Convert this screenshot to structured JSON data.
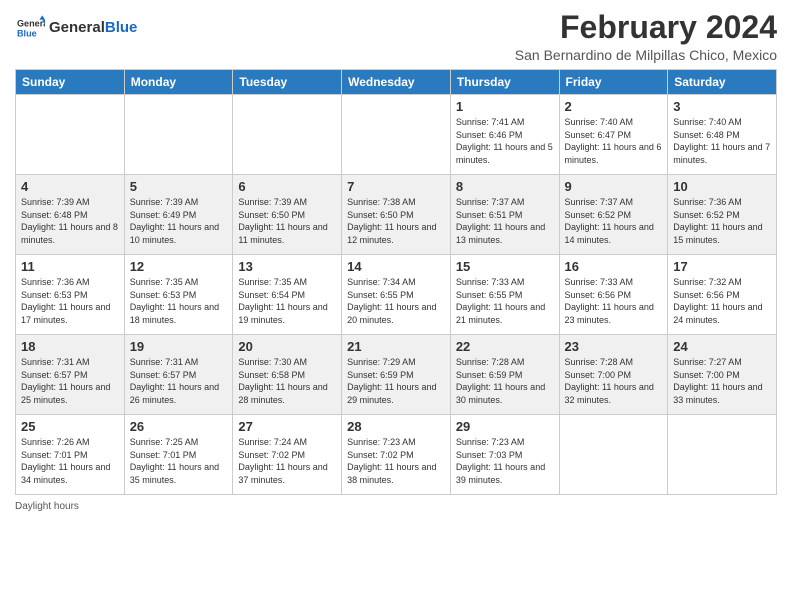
{
  "header": {
    "logo_general": "General",
    "logo_blue": "Blue",
    "month_title": "February 2024",
    "location": "San Bernardino de Milpillas Chico, Mexico"
  },
  "weekdays": [
    "Sunday",
    "Monday",
    "Tuesday",
    "Wednesday",
    "Thursday",
    "Friday",
    "Saturday"
  ],
  "weeks": [
    [
      {
        "day": "",
        "info": ""
      },
      {
        "day": "",
        "info": ""
      },
      {
        "day": "",
        "info": ""
      },
      {
        "day": "",
        "info": ""
      },
      {
        "day": "1",
        "info": "Sunrise: 7:41 AM\nSunset: 6:46 PM\nDaylight: 11 hours and 5 minutes."
      },
      {
        "day": "2",
        "info": "Sunrise: 7:40 AM\nSunset: 6:47 PM\nDaylight: 11 hours and 6 minutes."
      },
      {
        "day": "3",
        "info": "Sunrise: 7:40 AM\nSunset: 6:48 PM\nDaylight: 11 hours and 7 minutes."
      }
    ],
    [
      {
        "day": "4",
        "info": "Sunrise: 7:39 AM\nSunset: 6:48 PM\nDaylight: 11 hours and 8 minutes."
      },
      {
        "day": "5",
        "info": "Sunrise: 7:39 AM\nSunset: 6:49 PM\nDaylight: 11 hours and 10 minutes."
      },
      {
        "day": "6",
        "info": "Sunrise: 7:39 AM\nSunset: 6:50 PM\nDaylight: 11 hours and 11 minutes."
      },
      {
        "day": "7",
        "info": "Sunrise: 7:38 AM\nSunset: 6:50 PM\nDaylight: 11 hours and 12 minutes."
      },
      {
        "day": "8",
        "info": "Sunrise: 7:37 AM\nSunset: 6:51 PM\nDaylight: 11 hours and 13 minutes."
      },
      {
        "day": "9",
        "info": "Sunrise: 7:37 AM\nSunset: 6:52 PM\nDaylight: 11 hours and 14 minutes."
      },
      {
        "day": "10",
        "info": "Sunrise: 7:36 AM\nSunset: 6:52 PM\nDaylight: 11 hours and 15 minutes."
      }
    ],
    [
      {
        "day": "11",
        "info": "Sunrise: 7:36 AM\nSunset: 6:53 PM\nDaylight: 11 hours and 17 minutes."
      },
      {
        "day": "12",
        "info": "Sunrise: 7:35 AM\nSunset: 6:53 PM\nDaylight: 11 hours and 18 minutes."
      },
      {
        "day": "13",
        "info": "Sunrise: 7:35 AM\nSunset: 6:54 PM\nDaylight: 11 hours and 19 minutes."
      },
      {
        "day": "14",
        "info": "Sunrise: 7:34 AM\nSunset: 6:55 PM\nDaylight: 11 hours and 20 minutes."
      },
      {
        "day": "15",
        "info": "Sunrise: 7:33 AM\nSunset: 6:55 PM\nDaylight: 11 hours and 21 minutes."
      },
      {
        "day": "16",
        "info": "Sunrise: 7:33 AM\nSunset: 6:56 PM\nDaylight: 11 hours and 23 minutes."
      },
      {
        "day": "17",
        "info": "Sunrise: 7:32 AM\nSunset: 6:56 PM\nDaylight: 11 hours and 24 minutes."
      }
    ],
    [
      {
        "day": "18",
        "info": "Sunrise: 7:31 AM\nSunset: 6:57 PM\nDaylight: 11 hours and 25 minutes."
      },
      {
        "day": "19",
        "info": "Sunrise: 7:31 AM\nSunset: 6:57 PM\nDaylight: 11 hours and 26 minutes."
      },
      {
        "day": "20",
        "info": "Sunrise: 7:30 AM\nSunset: 6:58 PM\nDaylight: 11 hours and 28 minutes."
      },
      {
        "day": "21",
        "info": "Sunrise: 7:29 AM\nSunset: 6:59 PM\nDaylight: 11 hours and 29 minutes."
      },
      {
        "day": "22",
        "info": "Sunrise: 7:28 AM\nSunset: 6:59 PM\nDaylight: 11 hours and 30 minutes."
      },
      {
        "day": "23",
        "info": "Sunrise: 7:28 AM\nSunset: 7:00 PM\nDaylight: 11 hours and 32 minutes."
      },
      {
        "day": "24",
        "info": "Sunrise: 7:27 AM\nSunset: 7:00 PM\nDaylight: 11 hours and 33 minutes."
      }
    ],
    [
      {
        "day": "25",
        "info": "Sunrise: 7:26 AM\nSunset: 7:01 PM\nDaylight: 11 hours and 34 minutes."
      },
      {
        "day": "26",
        "info": "Sunrise: 7:25 AM\nSunset: 7:01 PM\nDaylight: 11 hours and 35 minutes."
      },
      {
        "day": "27",
        "info": "Sunrise: 7:24 AM\nSunset: 7:02 PM\nDaylight: 11 hours and 37 minutes."
      },
      {
        "day": "28",
        "info": "Sunrise: 7:23 AM\nSunset: 7:02 PM\nDaylight: 11 hours and 38 minutes."
      },
      {
        "day": "29",
        "info": "Sunrise: 7:23 AM\nSunset: 7:03 PM\nDaylight: 11 hours and 39 minutes."
      },
      {
        "day": "",
        "info": ""
      },
      {
        "day": "",
        "info": ""
      }
    ]
  ],
  "footer": {
    "daylight_label": "Daylight hours"
  }
}
